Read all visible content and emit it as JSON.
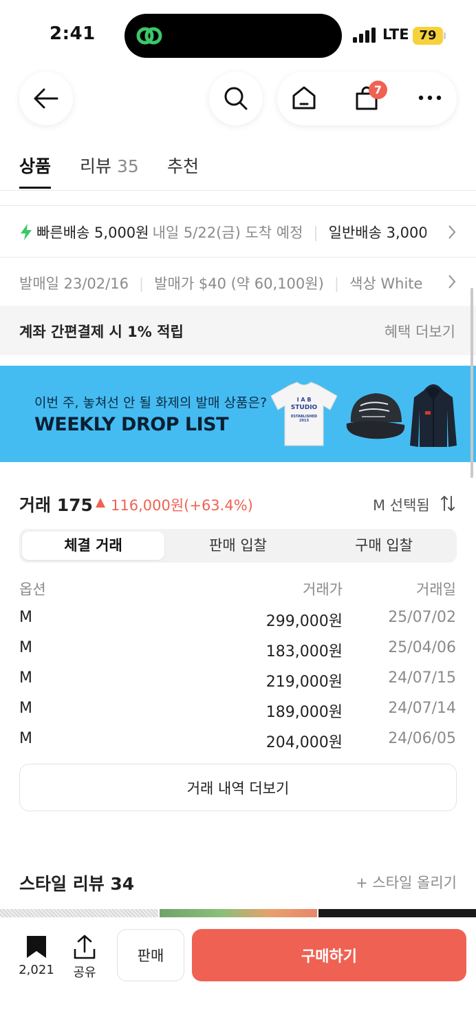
{
  "status_bar": {
    "time": "2:41",
    "network": "LTE",
    "battery": "79"
  },
  "nav": {
    "cart_badge": "7"
  },
  "tabs": [
    {
      "label": "상품",
      "count": ""
    },
    {
      "label": "리뷰",
      "count": "35"
    },
    {
      "label": "추천",
      "count": ""
    }
  ],
  "delivery": {
    "fast_label": "빠른배송 5,000원",
    "fast_eta": "내일 5/22(금) 도착 예정",
    "normal_label": "일반배송 3,000"
  },
  "product_info": {
    "release_date": "발매일 23/02/16",
    "release_price": "발매가 $40 (약 60,100원)",
    "color": "색상 White"
  },
  "benefit": {
    "text": "계좌 간편결제 시 1% 적립",
    "more": "혜택 더보기"
  },
  "banner": {
    "subtitle": "이번 주, 놓쳐선 안 될 화제의 발매 상품은?",
    "title": "WEEKLY DROP LIST",
    "tshirt_text": [
      "I A B",
      "STUDIO",
      "ESTABLISHED",
      "2013"
    ]
  },
  "trades": {
    "title": "거래 175",
    "change": "116,000원(+63.4%)",
    "size_filter": "M 선택됨",
    "segments": [
      "체결 거래",
      "판매 입찰",
      "구매 입찰"
    ],
    "active_segment": 0,
    "columns": [
      "옵션",
      "거래가",
      "거래일"
    ],
    "rows": [
      {
        "option": "M",
        "price": "299,000원",
        "date": "25/07/02"
      },
      {
        "option": "M",
        "price": "183,000원",
        "date": "25/04/06"
      },
      {
        "option": "M",
        "price": "219,000원",
        "date": "24/07/15"
      },
      {
        "option": "M",
        "price": "189,000원",
        "date": "24/07/14"
      },
      {
        "option": "M",
        "price": "204,000원",
        "date": "24/06/05"
      }
    ],
    "more_label": "거래 내역 더보기"
  },
  "style_review": {
    "title": "스타일 리뷰 34",
    "upload": "+ 스타일 올리기"
  },
  "bottom_bar": {
    "bookmark_count": "2,021",
    "share_label": "공유",
    "sell_label": "판매",
    "buy_label": "구매하기"
  },
  "colors": {
    "accent": "#ef6253",
    "banner": "#45bcf1",
    "bolt": "#3cc768",
    "battery": "#f7d13c"
  }
}
